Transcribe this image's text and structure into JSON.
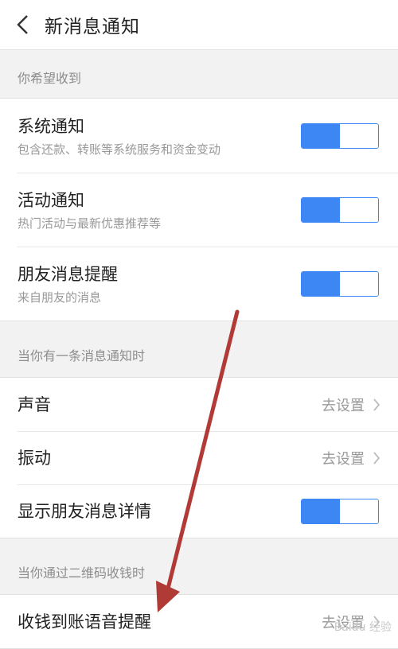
{
  "header": {
    "title": "新消息通知",
    "back_icon": "chevron-left-icon"
  },
  "section1": {
    "label": "你希望收到",
    "items": [
      {
        "title": "系统通知",
        "subtitle": "包含还款、转账等系统服务和资金变动",
        "enabled": true
      },
      {
        "title": "活动通知",
        "subtitle": "热门活动与最新优惠推荐等",
        "enabled": true
      },
      {
        "title": "朋友消息提醒",
        "subtitle": "来自朋友的消息",
        "enabled": true
      }
    ]
  },
  "section2": {
    "label": "当你有一条消息通知时",
    "items": [
      {
        "title": "声音",
        "action": "去设置"
      },
      {
        "title": "振动",
        "action": "去设置"
      },
      {
        "title": "显示朋友消息详情",
        "enabled": true
      }
    ]
  },
  "section3": {
    "label": "当你通过二维码收钱时",
    "items": [
      {
        "title": "收钱到账语音提醒",
        "action": "去设置"
      }
    ]
  },
  "colors": {
    "accent": "#3d87f5",
    "annotation_arrow": "#b03a36"
  }
}
